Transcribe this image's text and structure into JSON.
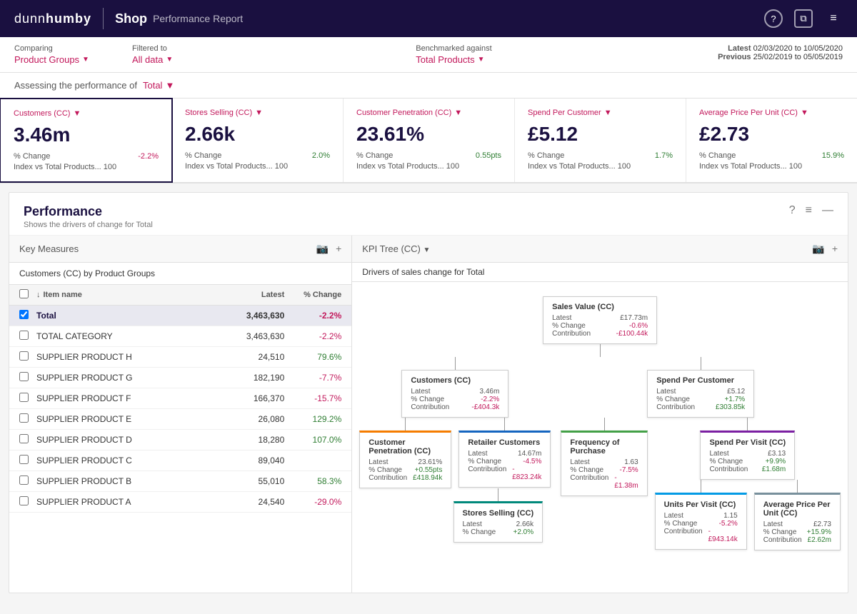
{
  "header": {
    "logo": "dunnhumby",
    "title_shop": "Shop",
    "title_sub": "Performance Report",
    "icons": [
      "?",
      "□",
      "≡"
    ]
  },
  "filter_bar": {
    "comparing_label": "Comparing",
    "comparing_value": "Product Groups",
    "filtered_label": "Filtered to",
    "filtered_value": "All data",
    "benchmarked_label": "Benchmarked against",
    "benchmarked_value": "Total Products",
    "latest_label": "Latest",
    "latest_dates": "02/03/2020 to 10/05/2020",
    "previous_label": "Previous",
    "previous_dates": "25/02/2019 to 05/05/2019"
  },
  "assessing": {
    "text": "Assessing the performance of",
    "value": "Total"
  },
  "kpi_cards": [
    {
      "id": "customers",
      "title": "Customers (CC)",
      "value": "3.46m",
      "pct_change_label": "% Change",
      "pct_change_value": "-2.2%",
      "index_label": "Index vs Total Products...",
      "index_value": "100",
      "is_active": true
    },
    {
      "id": "stores",
      "title": "Stores Selling (CC)",
      "value": "2.66k",
      "pct_change_label": "% Change",
      "pct_change_value": "2.0%",
      "index_label": "Index vs Total Products...",
      "index_value": "100",
      "is_active": false
    },
    {
      "id": "penetration",
      "title": "Customer Penetration (CC)",
      "value": "23.61%",
      "pct_change_label": "% Change",
      "pct_change_value": "0.55pts",
      "index_label": "Index vs Total Products...",
      "index_value": "100",
      "is_active": false
    },
    {
      "id": "spend",
      "title": "Spend Per Customer",
      "value": "£5.12",
      "pct_change_label": "% Change",
      "pct_change_value": "1.7%",
      "index_label": "Index vs Total Products...",
      "index_value": "100",
      "is_active": false
    },
    {
      "id": "avg_price",
      "title": "Average Price Per Unit (CC)",
      "value": "£2.73",
      "pct_change_label": "% Change",
      "pct_change_value": "15.9%",
      "index_label": "Index vs Total Products...",
      "index_value": "100",
      "is_active": false
    }
  ],
  "performance": {
    "title": "Performance",
    "subtitle": "Shows the drivers of change for Total",
    "key_measures_label": "Key Measures",
    "kpi_tree_label": "KPI Tree (CC)",
    "table_subtitle": "Customers (CC) by Product Groups",
    "tree_subtitle": "Drivers of sales change for Total",
    "col_item_name": "Item name",
    "col_latest": "Latest",
    "col_change": "% Change",
    "rows": [
      {
        "name": "Total",
        "latest": "3,463,630",
        "change": "-2.2%",
        "highlighted": true,
        "change_type": "negative"
      },
      {
        "name": "TOTAL CATEGORY",
        "latest": "3,463,630",
        "change": "-2.2%",
        "highlighted": false,
        "change_type": "negative"
      },
      {
        "name": "SUPPLIER PRODUCT H",
        "latest": "24,510",
        "change": "79.6%",
        "highlighted": false,
        "change_type": "positive"
      },
      {
        "name": "SUPPLIER PRODUCT G",
        "latest": "182,190",
        "change": "-7.7%",
        "highlighted": false,
        "change_type": "negative"
      },
      {
        "name": "SUPPLIER PRODUCT F",
        "latest": "166,370",
        "change": "-15.7%",
        "highlighted": false,
        "change_type": "negative"
      },
      {
        "name": "SUPPLIER PRODUCT E",
        "latest": "26,080",
        "change": "129.2%",
        "highlighted": false,
        "change_type": "positive"
      },
      {
        "name": "SUPPLIER PRODUCT D",
        "latest": "18,280",
        "change": "107.0%",
        "highlighted": false,
        "change_type": "positive"
      },
      {
        "name": "SUPPLIER PRODUCT C",
        "latest": "89,040",
        "change": "",
        "highlighted": false,
        "change_type": "blank"
      },
      {
        "name": "SUPPLIER PRODUCT B",
        "latest": "55,010",
        "change": "58.3%",
        "highlighted": false,
        "change_type": "positive"
      },
      {
        "name": "SUPPLIER PRODUCT A",
        "latest": "24,540",
        "change": "-29.0%",
        "highlighted": false,
        "change_type": "negative"
      }
    ],
    "kpi_tree": {
      "sales_value": {
        "title": "Sales Value (CC)",
        "latest_label": "Latest",
        "latest_val": "£17.73m",
        "change_label": "% Change",
        "change_val": "-0.6%",
        "contribution_label": "Contribution",
        "contribution_val": "-£100.44k"
      },
      "customers": {
        "title": "Customers (CC)",
        "latest_val": "3.46m",
        "change_val": "-2.2%",
        "contribution_val": "-£404.3k"
      },
      "spend_per_customer": {
        "title": "Spend Per Customer",
        "latest_val": "£5.12",
        "change_val": "+1.7%",
        "contribution_val": "£303.85k"
      },
      "customer_penetration": {
        "title": "Customer Penetration (CC)",
        "latest_val": "23.61%",
        "change_val": "+0.55pts",
        "contribution_val": "£418.94k"
      },
      "retailer_customers": {
        "title": "Retailer Customers",
        "latest_val": "14.67m",
        "change_val": "-4.5%",
        "contribution_val": "-£823.24k"
      },
      "frequency": {
        "title": "Frequency of Purchase",
        "latest_val": "1.63",
        "change_val": "-7.5%",
        "contribution_val": "-£1.38m"
      },
      "spend_per_visit": {
        "title": "Spend Per Visit (CC)",
        "latest_val": "£3.13",
        "change_val": "+9.9%",
        "contribution_val": "£1.68m"
      },
      "stores_selling": {
        "title": "Stores Selling (CC)",
        "latest_val": "2.66k",
        "change_val": "+2.0%"
      },
      "units_per_visit": {
        "title": "Units Per Visit (CC)",
        "latest_val": "1.15",
        "change_val": "-5.2%",
        "contribution_val": "-£943.14k"
      },
      "avg_price_unit": {
        "title": "Average Price Per Unit (CC)",
        "latest_val": "£2.73",
        "change_val": "+15.9%",
        "contribution_val": "£2.62m"
      }
    }
  }
}
